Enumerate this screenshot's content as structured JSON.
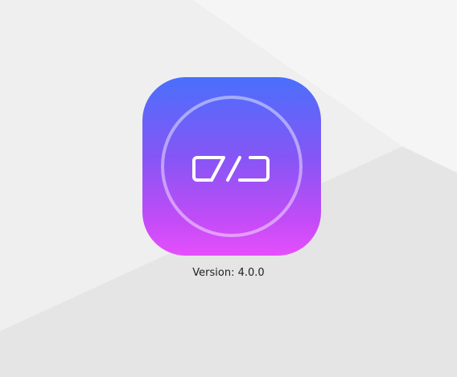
{
  "app": {
    "icon": "link-icon",
    "version_label": "Version: 4.0.0"
  },
  "colors": {
    "icon_gradient_top": "#4a6ffc",
    "icon_gradient_bottom": "#e54ffc",
    "background": "#eeeeee"
  }
}
